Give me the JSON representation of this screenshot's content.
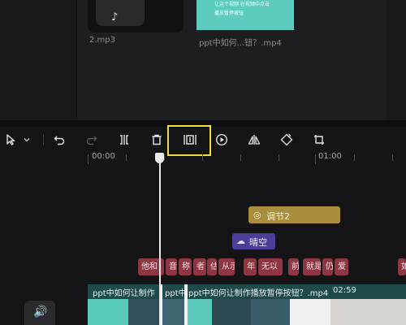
{
  "media": {
    "audio_icon": "♪",
    "audio_name": "2.mp3",
    "video_thumb_line1": "让这个视频 在视频中点击",
    "video_thumb_line2": "播放暂停按钮",
    "video_name": "ppt中如何...钮？.mp4"
  },
  "toolbar": {
    "icons": [
      "select-pointer-icon",
      "dropdown-icon",
      "undo-icon",
      "redo-icon",
      "split-icon",
      "delete-icon",
      "freeze-frame-icon",
      "play-reverse-icon",
      "mirror-icon",
      "rotate-icon",
      "crop-icon"
    ]
  },
  "ruler": {
    "start": "00:00",
    "minute": "01:00"
  },
  "effects": {
    "adjust_icon": "◎",
    "adjust_label": "调节2",
    "sky_icon": "☁",
    "sky_label": "晴空"
  },
  "captions": [
    "他和",
    "音",
    "称",
    "者",
    "估",
    "从示",
    "年",
    "无以",
    "前",
    "就是",
    "仍",
    "爱",
    "如"
  ],
  "track": {
    "title_a": "ppt中如何让制作",
    "title_b": "ppt中",
    "title_c": "ppt中如何让制作播放暂停按钮？.mp4",
    "duration": "02:59"
  },
  "mute_icon": "🔊",
  "colors": {
    "highlight": "#f5dc3a",
    "adjust": "#a98e3d",
    "sky": "#4c3d98",
    "caption": "#8e3643",
    "track": "#1e4a4a"
  }
}
